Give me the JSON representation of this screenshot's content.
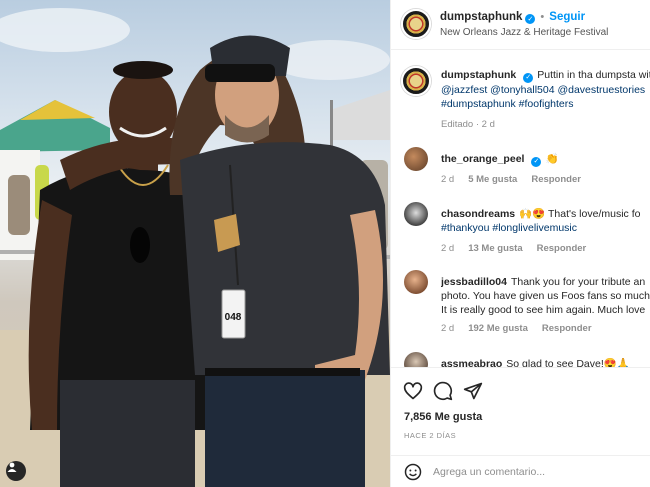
{
  "post": {
    "username": "dumpstaphunk",
    "follow_label": "Seguir",
    "separator": "•",
    "location": "New Orleans Jazz & Heritage Festival",
    "photo_badge": "048"
  },
  "caption": {
    "username": "dumpstaphunk",
    "line1": "Puttin in tha dumpsta wit",
    "line2": "@jazzfest @tonyhall504 @davestruestories",
    "line3": "#dumpstaphunk #foofighters",
    "meta": "Editado · 2 d"
  },
  "comments": [
    {
      "username": "the_orange_peel",
      "verified": true,
      "lines": [
        "👏"
      ],
      "age": "2 d",
      "likes": "5 Me gusta",
      "reply": "Responder"
    },
    {
      "username": "chasondreams",
      "verified": false,
      "lines": [
        "🙌😍 That's love/music fo",
        "#thankyou #longlivelivemusic"
      ],
      "age": "2 d",
      "likes": "13 Me gusta",
      "reply": "Responder"
    },
    {
      "username": "jessbadillo04",
      "verified": false,
      "lines": [
        "Thank you for your tribute an",
        "photo. You have given us Foos fans so much",
        "It is really good to see him again. Much love"
      ],
      "age": "2 d",
      "likes": "192 Me gusta",
      "reply": "Responder"
    },
    {
      "username": "assmeabrao",
      "verified": false,
      "lines": [
        "So glad to see Dave!😍🙏"
      ],
      "age": "",
      "likes": "",
      "reply": ""
    }
  ],
  "actions": {
    "likes": "7,856 Me gusta",
    "time_ago": "HACE 2 DÍAS",
    "comment_placeholder": "Agrega un comentario..."
  },
  "icons": {
    "like": "heart-icon",
    "comment": "comment-icon",
    "share": "share-icon",
    "emoji": "emoji-icon",
    "tagged_user": "user-tag-icon",
    "verified": "verified-badge-icon"
  },
  "colors": {
    "accent": "#0095f6",
    "hashtag": "#00376b",
    "muted": "#8e8e8e",
    "text": "#262626"
  }
}
